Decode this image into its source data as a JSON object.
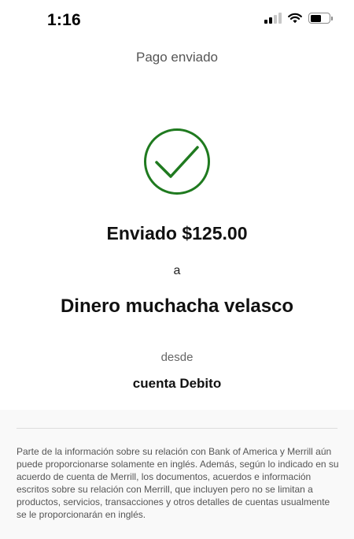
{
  "status_bar": {
    "time": "1:16",
    "signal_bars_filled": 2,
    "signal_bars_total": 4,
    "battery_level": 0.6
  },
  "header": {
    "title": "Pago enviado"
  },
  "confirmation": {
    "icon": "checkmark-circle-icon",
    "icon_color": "#1f7a1f",
    "sent_amount": "Enviado $125.00",
    "to_label": "a",
    "recipient_name": "Dinero muchacha velasco",
    "from_label": "desde",
    "account_name": "cuenta Debito"
  },
  "disclaimer": {
    "text": "Parte de la información sobre su relación con Bank of America y Merrill aún puede proporcionarse solamente en inglés. Además, según lo indicado en su acuerdo de cuenta de Merrill, los documentos, acuerdos e información escritos sobre su relación con Merrill, que incluyen pero no se limitan a productos, servicios, transacciones y otros detalles de cuentas usualmente se le proporcionarán en inglés."
  }
}
